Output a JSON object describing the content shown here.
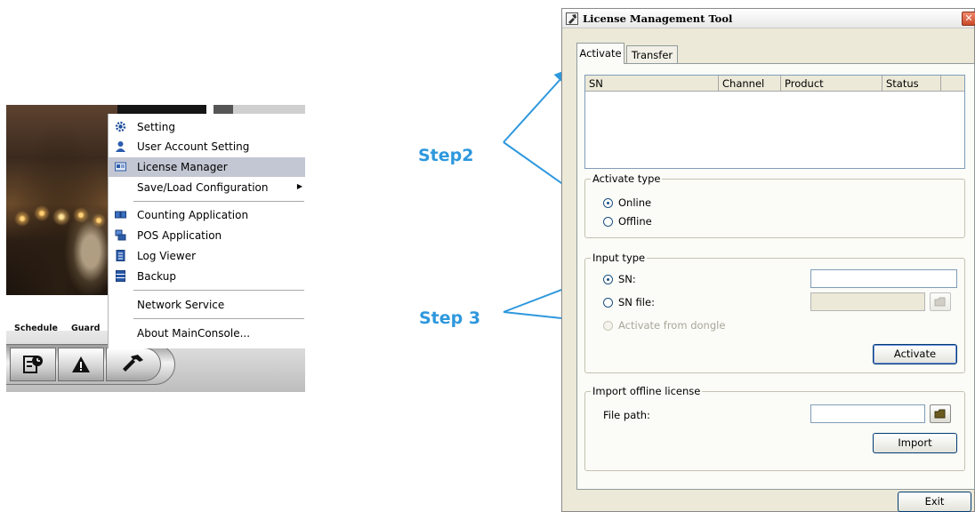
{
  "console": {
    "context_menu": {
      "items": [
        {
          "label": "Setting",
          "icon": "gear-icon"
        },
        {
          "label": "User Account Setting",
          "icon": "user-icon"
        },
        {
          "label": "License Manager",
          "icon": "license-icon"
        },
        {
          "label": "Save/Load Configuration",
          "icon": "",
          "submenu": true
        },
        {
          "label": "Counting Application",
          "icon": "counting-icon"
        },
        {
          "label": "POS Application",
          "icon": "pos-icon"
        },
        {
          "label": "Log Viewer",
          "icon": "log-icon"
        },
        {
          "label": "Backup",
          "icon": "backup-icon"
        },
        {
          "label": "Network Service",
          "icon": ""
        },
        {
          "label": "About MainConsole...",
          "icon": ""
        }
      ],
      "highlighted": "License Manager"
    },
    "toolbar": {
      "schedule_label": "Schedule",
      "guard_label": "Guard"
    }
  },
  "annotations": {
    "step2": "Step2",
    "step3": "Step 3",
    "arrow_color": "#2e98dd"
  },
  "window": {
    "title": "License Management Tool",
    "close_glyph": "✕",
    "tabs": [
      {
        "label": "Activate",
        "active": true
      },
      {
        "label": "Transfer",
        "active": false
      }
    ],
    "list_columns": [
      "SN",
      "Channel",
      "Product",
      "Status"
    ],
    "activate_type": {
      "title": "Activate type",
      "options": [
        {
          "label": "Online",
          "selected": true
        },
        {
          "label": "Offline",
          "selected": false
        }
      ]
    },
    "input_type": {
      "title": "Input type",
      "options": [
        {
          "label": "SN:",
          "selected": true,
          "enabled": true
        },
        {
          "label": "SN file:",
          "selected": false,
          "enabled": true
        },
        {
          "label": "Activate from dongle",
          "selected": false,
          "enabled": false
        }
      ],
      "sn_value": "",
      "sn_file_value": "",
      "activate_button": "Activate"
    },
    "import_offline": {
      "title": "Import offline license",
      "file_path_label": "File path:",
      "file_path_value": "",
      "import_button": "Import"
    },
    "exit_button": "Exit"
  }
}
